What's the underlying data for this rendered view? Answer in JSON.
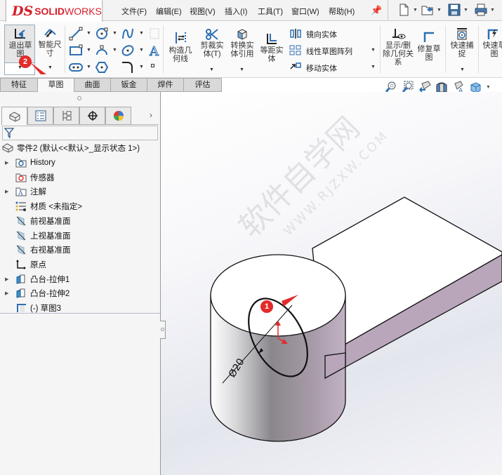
{
  "app": {
    "logo_ds": "DS",
    "logo_solid": "SOLID",
    "logo_works": "WORKS"
  },
  "menu": [
    {
      "label": "文件(F)"
    },
    {
      "label": "编辑(E)"
    },
    {
      "label": "视图(V)"
    },
    {
      "label": "插入(I)"
    },
    {
      "label": "工具(T)"
    },
    {
      "label": "窗口(W)"
    },
    {
      "label": "帮助(H)"
    }
  ],
  "quick_access": [
    {
      "icon": "new-document-icon"
    },
    {
      "icon": "open-folder-icon"
    },
    {
      "icon": "save-icon"
    },
    {
      "icon": "print-icon"
    }
  ],
  "ribbon": {
    "exit_sketch": "退出草图",
    "smart_dimension": "智能尺寸",
    "construction_geometry": "构造几何线",
    "trim_entities": "剪裁实体(T)",
    "convert_entities": "转换实体引用",
    "offset_entities": "等距实体",
    "mirror_entities": "镜向实体",
    "linear_pattern": "线性草图阵列",
    "move_entities": "移动实体",
    "display_relations": "显示/删除几何关系",
    "repair_sketch": "修复草图",
    "quick_snaps": "快速捕捉",
    "rapid_sketch": "快速草图"
  },
  "tabs": [
    {
      "label": "特征",
      "active": false
    },
    {
      "label": "草图",
      "active": true
    },
    {
      "label": "曲面",
      "active": false
    },
    {
      "label": "钣金",
      "active": false
    },
    {
      "label": "焊件",
      "active": false
    },
    {
      "label": "评估",
      "active": false
    }
  ],
  "feature_tree": {
    "root": "零件2 (默认<<默认>_显示状态 1>)",
    "items": [
      {
        "label": "History",
        "icon": "history-folder-icon",
        "expandable": true
      },
      {
        "label": "传感器",
        "icon": "sensor-folder-icon",
        "expandable": false
      },
      {
        "label": "注解",
        "icon": "annotation-folder-icon",
        "expandable": true
      },
      {
        "label": "材质 <未指定>",
        "icon": "material-icon",
        "expandable": false
      },
      {
        "label": "前视基准面",
        "icon": "plane-icon",
        "expandable": false
      },
      {
        "label": "上视基准面",
        "icon": "plane-icon",
        "expandable": false
      },
      {
        "label": "右视基准面",
        "icon": "plane-icon",
        "expandable": false
      },
      {
        "label": "原点",
        "icon": "origin-icon",
        "expandable": false
      },
      {
        "label": "凸台-拉伸1",
        "icon": "boss-extrude-icon",
        "expandable": true
      },
      {
        "label": "凸台-拉伸2",
        "icon": "boss-extrude-icon",
        "expandable": true
      },
      {
        "label": "(-) 草图3",
        "icon": "sketch-icon",
        "expandable": false
      }
    ]
  },
  "viewport": {
    "dimension_label": "Ø20",
    "watermark_cn": "软件自学网",
    "watermark_url": "WWW.RJZXW.COM",
    "callouts": [
      {
        "number": "1"
      },
      {
        "number": "2"
      }
    ]
  },
  "colors": {
    "accent_red": "#e32b2b",
    "brand_red": "#d41f2a",
    "part_side": "#b9a6bb",
    "icon_blue": "#2d6fb3"
  }
}
